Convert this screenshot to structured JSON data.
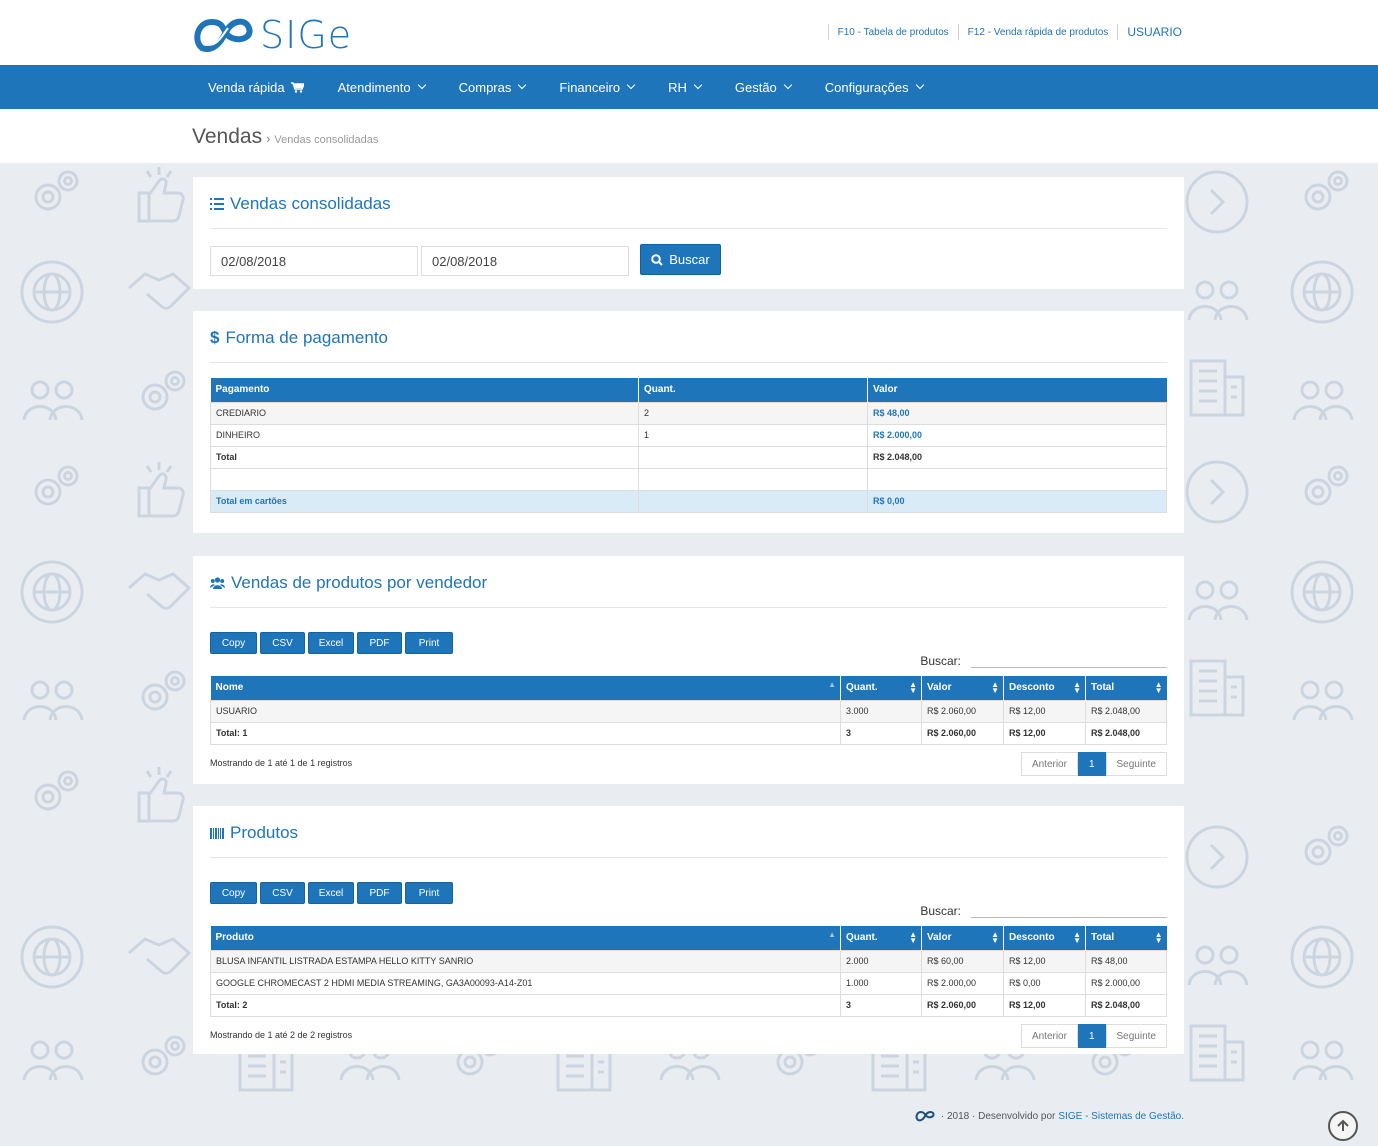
{
  "header": {
    "logo_text": "SIGe",
    "link_f10": "F10 - Tabela de produtos",
    "link_f12": "F12 - Venda rápida de produtos",
    "user": "USUARIO"
  },
  "nav": {
    "items": [
      {
        "label": "Venda rápida"
      },
      {
        "label": "Atendimento"
      },
      {
        "label": "Compras"
      },
      {
        "label": "Financeiro"
      },
      {
        "label": "RH"
      },
      {
        "label": "Gestão"
      },
      {
        "label": "Configurações"
      }
    ]
  },
  "breadcrumb": {
    "title": "Vendas",
    "sub": "Vendas consolidadas"
  },
  "filter_panel": {
    "title": "Vendas consolidadas",
    "date_from": "02/08/2018",
    "date_to": "02/08/2018",
    "search_button": "Buscar"
  },
  "payment_panel": {
    "title": "Forma de pagamento",
    "headers": [
      "Pagamento",
      "Quant.",
      "Valor"
    ],
    "rows": [
      [
        "CREDIARIO",
        "2",
        "R$ 48,00"
      ],
      [
        "DINHEIRO",
        "1",
        "R$ 2.000,00"
      ],
      [
        "Total",
        "",
        "R$ 2.048,00"
      ]
    ],
    "cards_row": [
      "Total em cartões",
      "",
      "R$ 0,00"
    ]
  },
  "export_buttons": [
    "Copy",
    "CSV",
    "Excel",
    "PDF",
    "Print"
  ],
  "search_label": "Buscar:",
  "pager": {
    "prev": "Anterior",
    "page": "1",
    "next": "Seguinte"
  },
  "seller_panel": {
    "title": "Vendas de produtos por vendedor",
    "headers": [
      "Nome",
      "Quant.",
      "Valor",
      "Desconto",
      "Total"
    ],
    "rows": [
      [
        "USUARIO",
        "3.000",
        "R$ 2.060,00",
        "R$ 12,00",
        "R$ 2.048,00"
      ]
    ],
    "total_row": [
      "Total: 1",
      "3",
      "R$ 2.060,00",
      "R$ 12,00",
      "R$ 2.048,00"
    ],
    "info": "Mostrando de 1 até 1 de 1 registros"
  },
  "products_panel": {
    "title": "Produtos",
    "headers": [
      "Produto",
      "Quant.",
      "Valor",
      "Desconto",
      "Total"
    ],
    "rows": [
      [
        "BLUSA INFANTIL LISTRADA ESTAMPA HELLO KITTY SANRIO",
        "2.000",
        "R$ 60,00",
        "R$ 12,00",
        "R$ 48,00"
      ],
      [
        "GOOGLE CHROMECAST 2 HDMI MEDIA STREAMING, GA3A00093-A14-Z01",
        "1.000",
        "R$ 2.000,00",
        "R$ 0,00",
        "R$ 2.000,00"
      ]
    ],
    "total_row": [
      "Total: 2",
      "3",
      "R$ 2.060,00",
      "R$ 12,00",
      "R$ 2.048,00"
    ],
    "info": "Mostrando de 1 até 2 de 2 registros"
  },
  "footer": {
    "text": "· 2018 · Desenvolvido por",
    "link": "SIGE - Sistemas de Gestão."
  },
  "colors": {
    "primary": "#1f75b9",
    "background": "#e9edf2"
  }
}
